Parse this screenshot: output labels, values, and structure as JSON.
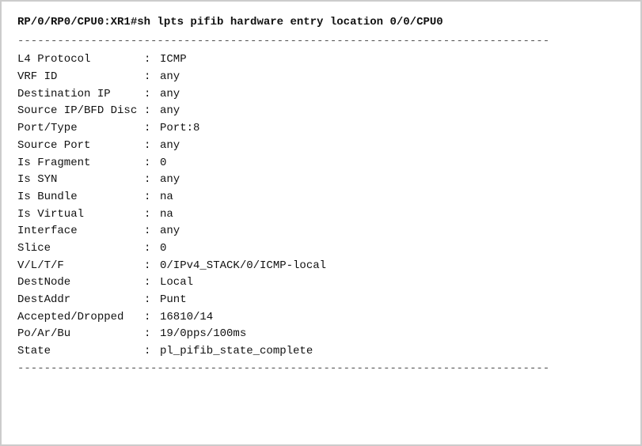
{
  "terminal": {
    "command": "RP/0/RP0/CPU0:XR1#sh lpts pifib hardware entry location 0/0/CPU0",
    "divider": "--------------------------------------------------------------------------------",
    "rows": [
      {
        "key": "L4 Protocol",
        "sep": ": ",
        "val": "ICMP"
      },
      {
        "key": "VRF ID",
        "sep": ": ",
        "val": "any"
      },
      {
        "key": "Destination IP",
        "sep": ": ",
        "val": "any"
      },
      {
        "key": "Source IP/BFD Disc",
        "sep": ": ",
        "val": "any"
      },
      {
        "key": "Port/Type",
        "sep": ": ",
        "val": "Port:8"
      },
      {
        "key": "Source Port",
        "sep": ": ",
        "val": "any"
      },
      {
        "key": "Is Fragment",
        "sep": ": ",
        "val": "0"
      },
      {
        "key": "Is SYN",
        "sep": ": ",
        "val": "any"
      },
      {
        "key": "Is Bundle",
        "sep": ": ",
        "val": "na"
      },
      {
        "key": "Is Virtual",
        "sep": ": ",
        "val": "na"
      },
      {
        "key": "Interface",
        "sep": ": ",
        "val": "any"
      },
      {
        "key": "Slice",
        "sep": ": ",
        "val": "0"
      },
      {
        "key": "V/L/T/F",
        "sep": ": ",
        "val": "0/IPv4_STACK/0/ICMP-local"
      },
      {
        "key": "DestNode",
        "sep": ": ",
        "val": "Local"
      },
      {
        "key": "DestAddr",
        "sep": ": ",
        "val": "Punt"
      },
      {
        "key": "Accepted/Dropped",
        "sep": ": ",
        "val": "16810/14"
      },
      {
        "key": "Po/Ar/Bu",
        "sep": ": ",
        "val": "19/0pps/100ms"
      },
      {
        "key": "State",
        "sep": ": ",
        "val": "pl_pifib_state_complete"
      }
    ]
  }
}
